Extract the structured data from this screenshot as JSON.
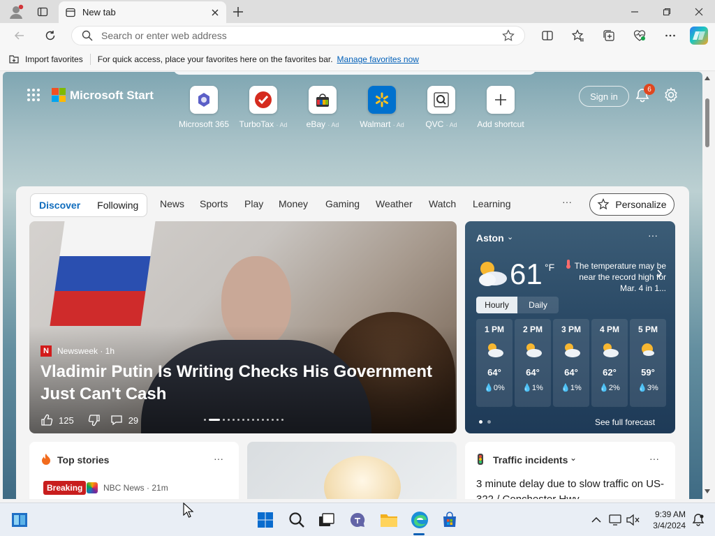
{
  "tab": {
    "title": "New tab"
  },
  "address": {
    "placeholder": "Search or enter web address"
  },
  "favorites": {
    "import_label": "Import favorites",
    "message": "For quick access, place your favorites here on the favorites bar.",
    "link": "Manage favorites now"
  },
  "start": {
    "brand": "Microsoft Start",
    "shortcuts": [
      {
        "name": "Microsoft 365",
        "ad": ""
      },
      {
        "name": "TurboTax",
        "ad": "· Ad"
      },
      {
        "name": "eBay",
        "ad": "· Ad"
      },
      {
        "name": "Walmart",
        "ad": "· Ad"
      },
      {
        "name": "QVC",
        "ad": "· Ad"
      },
      {
        "name": "Add shortcut",
        "ad": ""
      }
    ],
    "signin": "Sign in",
    "notifications": "6"
  },
  "feed": {
    "pills": [
      "Discover",
      "Following"
    ],
    "nav": [
      "News",
      "Sports",
      "Play",
      "Money",
      "Gaming",
      "Weather",
      "Watch",
      "Learning"
    ],
    "more": "···",
    "personalize": "Personalize"
  },
  "hero": {
    "source": "Newsweek · 1h",
    "title": "Vladimir Putin Is Writing Checks His Government Just Can't Cash",
    "likes": "125",
    "comments": "29"
  },
  "weather": {
    "city": "Aston",
    "temp": "61",
    "unit": "°F",
    "note": "The temperature may be near the record high for Mar. 4 in 1...",
    "tabs": [
      "Hourly",
      "Daily"
    ],
    "hours": [
      {
        "time": "1 PM",
        "temp": "64°",
        "precip": "0%"
      },
      {
        "time": "2 PM",
        "temp": "64°",
        "precip": "1%"
      },
      {
        "time": "3 PM",
        "temp": "64°",
        "precip": "1%"
      },
      {
        "time": "4 PM",
        "temp": "62°",
        "precip": "2%"
      },
      {
        "time": "5 PM",
        "temp": "59°",
        "precip": "3%"
      }
    ],
    "full": "See full forecast",
    "more": "···"
  },
  "cards": {
    "top_stories": "Top stories",
    "breaking": "Breaking",
    "nbc": "NBC News · 21m",
    "traffic_title": "Traffic incidents",
    "traffic_text": "3 minute delay due to slow traffic on US-322 / Conchester Hwy",
    "more": "···"
  },
  "clock": {
    "time": "9:39 AM",
    "date": "3/4/2024"
  },
  "colors": {
    "accent": "#0f6cbd",
    "brand_blue": "#0078d4",
    "badge": "#e0471f"
  }
}
